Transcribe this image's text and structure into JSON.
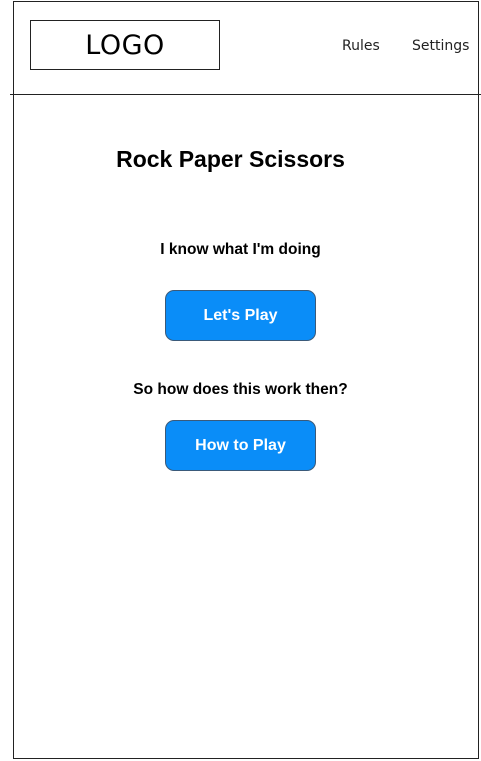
{
  "header": {
    "logo": "LOGO",
    "nav": {
      "rules": "Rules",
      "settings": "Settings"
    }
  },
  "main": {
    "title": "Rock Paper Scissors",
    "experienced_prompt": "I know what I'm doing",
    "play_button": "Let's Play",
    "newcomer_prompt": "So how does this work then?",
    "howto_button": "How to Play"
  },
  "colors": {
    "button_bg": "#0a8df8",
    "button_text": "#ffffff",
    "sketch_line": "#222222"
  }
}
